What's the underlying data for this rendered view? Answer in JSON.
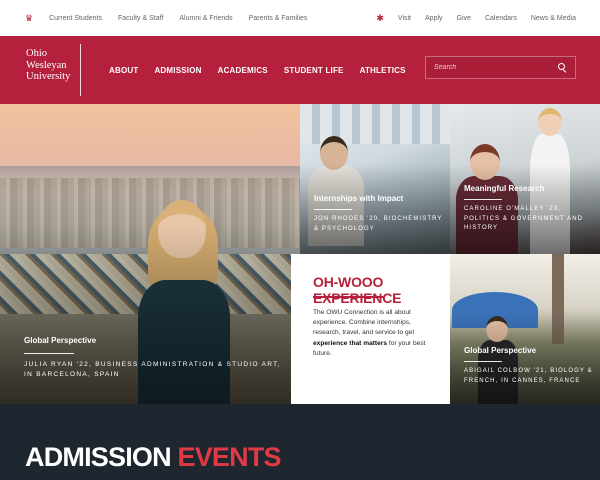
{
  "topbar": {
    "left_links": [
      "Current Students",
      "Faculty & Staff",
      "Alumni & Friends",
      "Parents & Families"
    ],
    "right_links": [
      "Visit",
      "Apply",
      "Give",
      "Calendars",
      "News & Media"
    ]
  },
  "header": {
    "logo_line1": "Ohio",
    "logo_line2": "Wesleyan",
    "logo_line3": "University",
    "nav": [
      "ABOUT",
      "ADMISSION",
      "ACADEMICS",
      "STUDENT LIFE",
      "ATHLETICS"
    ],
    "search_placeholder": "Search"
  },
  "tiles": {
    "big": {
      "title": "Global Perspective",
      "subtitle": "Julia Ryan '22, Business Administration & Studio Art, in Barcelona, Spain"
    },
    "internships": {
      "title": "Internships with Impact",
      "subtitle": "Jon Rhodes '20, Biochemistry & Psychology"
    },
    "research": {
      "title": "Meaningful Research",
      "subtitle": "Caroline O'Malley '23, Politics & Government and History"
    },
    "global2": {
      "title": "Global Perspective",
      "subtitle": "Abigail Colbow '21, Biology & French, in Cannes, France"
    }
  },
  "experience": {
    "title": "OH-WOOO EXPERIENCE",
    "body_start": "The OWU Connection is all about experience. Combine internships, research, travel, and service to get ",
    "body_bold": "experience that matters",
    "body_end": " for your best future."
  },
  "admission_events": {
    "word1": "ADMISSION",
    "word2": "EVENTS"
  },
  "colors": {
    "brand_red": "#b5203c",
    "dark_band": "#1e2630",
    "events_red": "#e03a45"
  }
}
